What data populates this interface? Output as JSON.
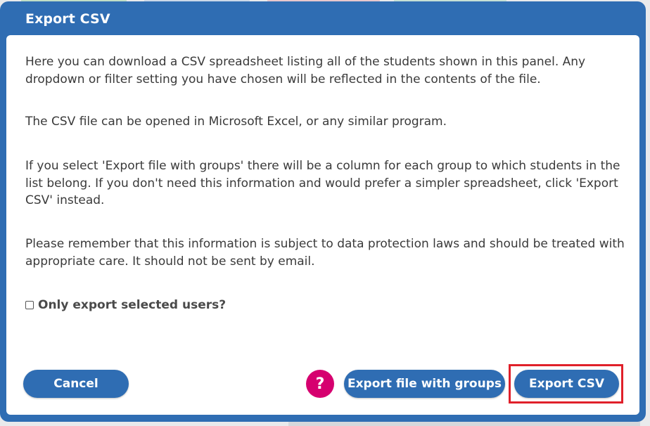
{
  "dialog": {
    "title": "Export CSV",
    "paragraphs": [
      "Here you can download a CSV spreadsheet listing all of the students shown in this panel. Any dropdown or filter setting you have chosen will be reflected in the contents of the file.",
      "The CSV file can be opened in Microsoft Excel, or any similar program.",
      "If you select 'Export file with groups' there will be a column for each group to which students in the list belong. If you don't need this information and would prefer a simpler spreadsheet, click 'Export CSV' instead.",
      "Please remember that this information is subject to data protection laws and should be treated with appropriate care. It should not be sent by email."
    ],
    "checkbox": {
      "label": "Only export selected users?",
      "checked": false
    }
  },
  "buttons": {
    "cancel": "Cancel",
    "help": "?",
    "export_with_groups": "Export file with groups",
    "export_csv": "Export CSV"
  },
  "colors": {
    "primary": "#2f6db3",
    "help": "#d6006f",
    "highlight": "#e0202a"
  }
}
